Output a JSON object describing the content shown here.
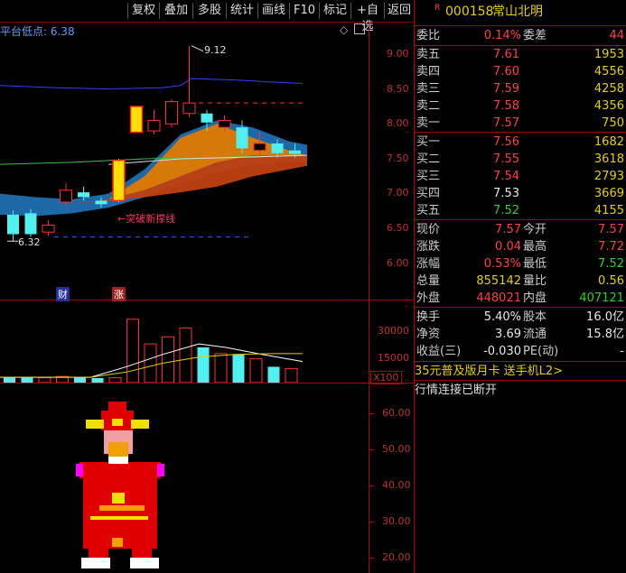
{
  "toolbar": {
    "buttons": [
      "复权",
      "叠加",
      "多股",
      "统计",
      "画线",
      "F10",
      "标记",
      "+自选",
      "返回"
    ]
  },
  "chart": {
    "indicator_label": "平台低点: 6.38",
    "price_ticks": [
      "9.00",
      "8.50",
      "8.00",
      "7.50",
      "7.00",
      "6.50",
      "6.00"
    ],
    "high_marker": "9.12",
    "low_marker": "6.32",
    "annotation": "←突破新撑线",
    "badge_cai": "财",
    "badge_zhang": "涨",
    "volume_ticks": [
      "30000",
      "15000"
    ],
    "volume_unit": "X100",
    "lower_ticks": [
      "60.00",
      "50.00",
      "40.00",
      "30.00",
      "20.00"
    ]
  },
  "chart_data": {
    "type": "candlestick",
    "candles": [
      {
        "o": 6.7,
        "c": 6.42,
        "h": 6.76,
        "l": 6.32,
        "up": false
      },
      {
        "o": 6.72,
        "c": 6.42,
        "h": 6.78,
        "l": 6.38,
        "up": false
      },
      {
        "o": 6.55,
        "c": 6.45,
        "h": 6.62,
        "l": 6.4,
        "up": true
      },
      {
        "o": 6.88,
        "c": 7.05,
        "h": 7.15,
        "l": 6.82,
        "up": true
      },
      {
        "o": 6.95,
        "c": 7.02,
        "h": 7.1,
        "l": 6.9,
        "up": false
      },
      {
        "o": 6.9,
        "c": 6.85,
        "h": 6.95,
        "l": 6.8,
        "up": false
      },
      {
        "o": 6.9,
        "c": 7.48,
        "h": 7.5,
        "l": 6.88,
        "up": true,
        "limit": true
      },
      {
        "o": 7.88,
        "c": 8.25,
        "h": 8.25,
        "l": 7.88,
        "up": true,
        "limit": true
      },
      {
        "o": 7.9,
        "c": 8.05,
        "h": 8.2,
        "l": 7.85,
        "up": true
      },
      {
        "o": 8.0,
        "c": 8.32,
        "h": 8.35,
        "l": 7.95,
        "up": true
      },
      {
        "o": 8.15,
        "c": 8.3,
        "h": 9.12,
        "l": 8.1,
        "up": true
      },
      {
        "o": 8.15,
        "c": 8.02,
        "h": 8.2,
        "l": 7.9,
        "up": false
      },
      {
        "o": 7.95,
        "c": 8.05,
        "h": 8.12,
        "l": 7.9,
        "up": true
      },
      {
        "o": 7.95,
        "c": 7.65,
        "h": 8.05,
        "l": 7.58,
        "up": false
      },
      {
        "o": 7.62,
        "c": 7.72,
        "h": 7.88,
        "l": 7.55,
        "up": true
      },
      {
        "o": 7.72,
        "c": 7.58,
        "h": 7.78,
        "l": 7.52,
        "up": false
      },
      {
        "o": 7.62,
        "c": 7.57,
        "h": 7.72,
        "l": 7.52,
        "up": false
      }
    ],
    "volume": [
      {
        "v": 3200,
        "up": false
      },
      {
        "v": 3000,
        "up": false
      },
      {
        "v": 2800,
        "up": true
      },
      {
        "v": 3500,
        "up": true
      },
      {
        "v": 2900,
        "up": false
      },
      {
        "v": 2600,
        "up": false
      },
      {
        "v": 2800,
        "up": true
      },
      {
        "v": 36000,
        "up": true
      },
      {
        "v": 22000,
        "up": true
      },
      {
        "v": 26000,
        "up": true
      },
      {
        "v": 31000,
        "up": true
      },
      {
        "v": 20000,
        "up": false
      },
      {
        "v": 16500,
        "up": true
      },
      {
        "v": 16000,
        "up": false
      },
      {
        "v": 13500,
        "up": true
      },
      {
        "v": 9000,
        "up": false
      },
      {
        "v": 8000,
        "up": true
      }
    ],
    "ylim": [
      5.85,
      9.35
    ]
  },
  "quote": {
    "stock_mark": "R",
    "stock_code": "000158",
    "stock_name": "常山北明",
    "weibi_label": "委比",
    "weibi": "0.14%",
    "weicha_label": "委差",
    "weicha": "44",
    "sells": [
      {
        "label": "卖五",
        "price": "7.61",
        "vol": "1953"
      },
      {
        "label": "卖四",
        "price": "7.60",
        "vol": "4556"
      },
      {
        "label": "卖三",
        "price": "7.59",
        "vol": "4258"
      },
      {
        "label": "卖二",
        "price": "7.58",
        "vol": "4356"
      },
      {
        "label": "卖一",
        "price": "7.57",
        "vol": "750"
      }
    ],
    "buys": [
      {
        "label": "买一",
        "price": "7.56",
        "vol": "1682",
        "pc": "red"
      },
      {
        "label": "买二",
        "price": "7.55",
        "vol": "3618",
        "pc": "red"
      },
      {
        "label": "买三",
        "price": "7.54",
        "vol": "2793",
        "pc": "red"
      },
      {
        "label": "买四",
        "price": "7.53",
        "vol": "3669",
        "pc": "white"
      },
      {
        "label": "买五",
        "price": "7.52",
        "vol": "4155",
        "pc": "green"
      }
    ],
    "stats": [
      {
        "l1": "现价",
        "v1": "7.57",
        "c1": "red",
        "l2": "今开",
        "v2": "7.57",
        "c2": "red"
      },
      {
        "l1": "涨跌",
        "v1": "0.04",
        "c1": "red",
        "l2": "最高",
        "v2": "7.72",
        "c2": "red"
      },
      {
        "l1": "涨幅",
        "v1": "0.53%",
        "c1": "red",
        "l2": "最低",
        "v2": "7.52",
        "c2": "green"
      },
      {
        "l1": "总量",
        "v1": "855142",
        "c1": "yellow",
        "l2": "量比",
        "v2": "0.56",
        "c2": "yellow"
      },
      {
        "l1": "外盘",
        "v1": "448021",
        "c1": "red",
        "l2": "内盘",
        "v2": "407121",
        "c2": "green"
      }
    ],
    "stats2": [
      {
        "l1": "换手",
        "v1": "5.40%",
        "l2": "股本",
        "v2": "16.0亿"
      },
      {
        "l1": "净资",
        "v1": "3.69",
        "l2": "流通",
        "v2": "15.8亿"
      },
      {
        "l1": "收益(三)",
        "v1": "-0.030",
        "l2": "PE(动)",
        "v2": "-"
      }
    ],
    "promo": "35元普及版月卡 送手机L2>",
    "status": "行情连接已断开"
  },
  "colors": {
    "up": "#ff3030",
    "down": "#50f0f0",
    "grid": "#b00000",
    "yellow": "#e8d000"
  }
}
